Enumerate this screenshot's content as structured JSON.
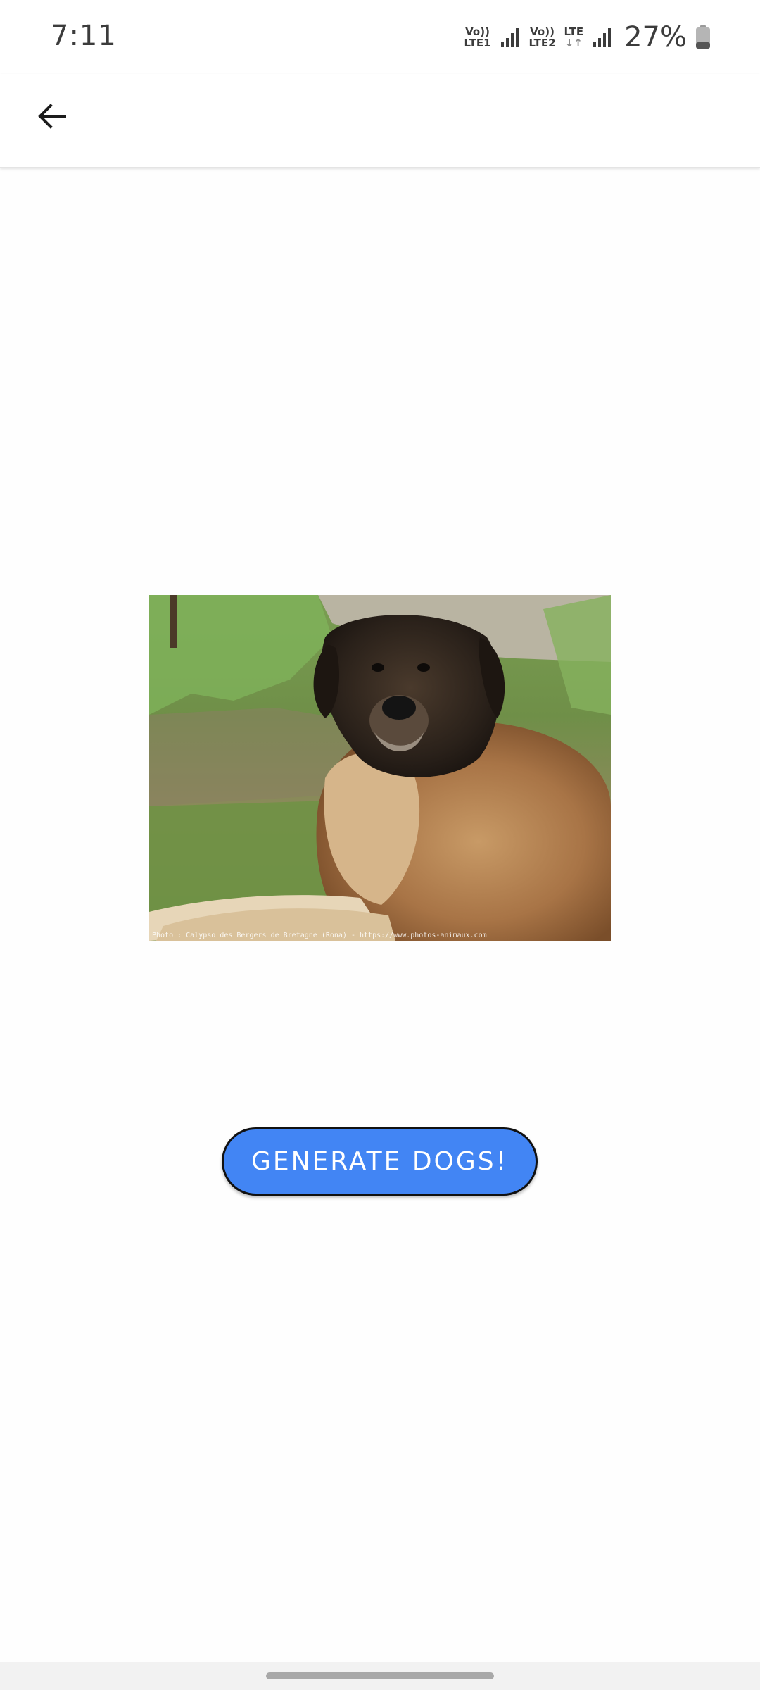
{
  "status_bar": {
    "time": "7:11",
    "sim1": {
      "top": "Vo))",
      "bottom": "LTE1"
    },
    "sim2": {
      "top": "Vo))",
      "bottom": "LTE2"
    },
    "data": {
      "top": "LTE",
      "bottom": "↓↑"
    },
    "battery_percent": "27%",
    "icons": [
      "signal-icon",
      "signal-icon",
      "signal-icon",
      "battery-icon"
    ]
  },
  "app_bar": {
    "back_icon": "arrow-left-icon"
  },
  "main": {
    "image_credit": "Photo : Calypso des Bergers de Bretagne (Rona) - https://www.photos-animaux.com",
    "generate_button_label": "GENERATE DOGS!"
  },
  "colors": {
    "button_fill": "#4285f4",
    "button_border": "#111111",
    "background": "#fefefe"
  }
}
